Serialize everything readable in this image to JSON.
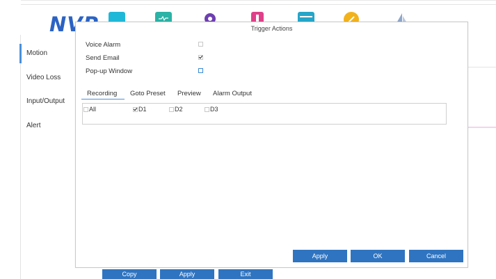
{
  "app": {
    "logo": "NVP"
  },
  "top_icons": [
    {
      "name": "camera-icon",
      "color": "#20b8d8"
    },
    {
      "name": "network-icon",
      "color": "#2ab3a6"
    },
    {
      "name": "settings-icon",
      "color": "#6d3fb0"
    },
    {
      "name": "storage-icon",
      "color": "#e0408a"
    },
    {
      "name": "system-icon",
      "color": "#25a6c9"
    },
    {
      "name": "maintenance-icon",
      "color": "#f2b21c"
    },
    {
      "name": "shutdown-icon",
      "color": "#8fa6c8"
    }
  ],
  "sidebar": {
    "items": [
      {
        "label": "Motion",
        "active": true
      },
      {
        "label": "Video Loss"
      },
      {
        "label": "Input/Output"
      },
      {
        "label": "Alert"
      }
    ]
  },
  "background_buttons": {
    "copy": "Copy",
    "apply": "Apply",
    "exit": "Exit"
  },
  "dialog": {
    "title": "Trigger Actions",
    "options": [
      {
        "label": "Voice Alarm",
        "checked": false
      },
      {
        "label": "Send Email",
        "checked": true
      },
      {
        "label": "Pop-up Window",
        "checked": false
      }
    ],
    "tabs": [
      "Recording",
      "Goto Preset",
      "Preview",
      "Alarm Output"
    ],
    "active_tab": "Recording",
    "channels": [
      {
        "label": "All",
        "checked": false
      },
      {
        "label": "D1",
        "checked": true
      },
      {
        "label": "D2",
        "checked": false
      },
      {
        "label": "D3",
        "checked": false
      }
    ],
    "buttons": {
      "apply": "Apply",
      "ok": "OK",
      "cancel": "Cancel"
    }
  },
  "colors": {
    "accent": "#2f74c0",
    "logo": "#2b63c4"
  }
}
